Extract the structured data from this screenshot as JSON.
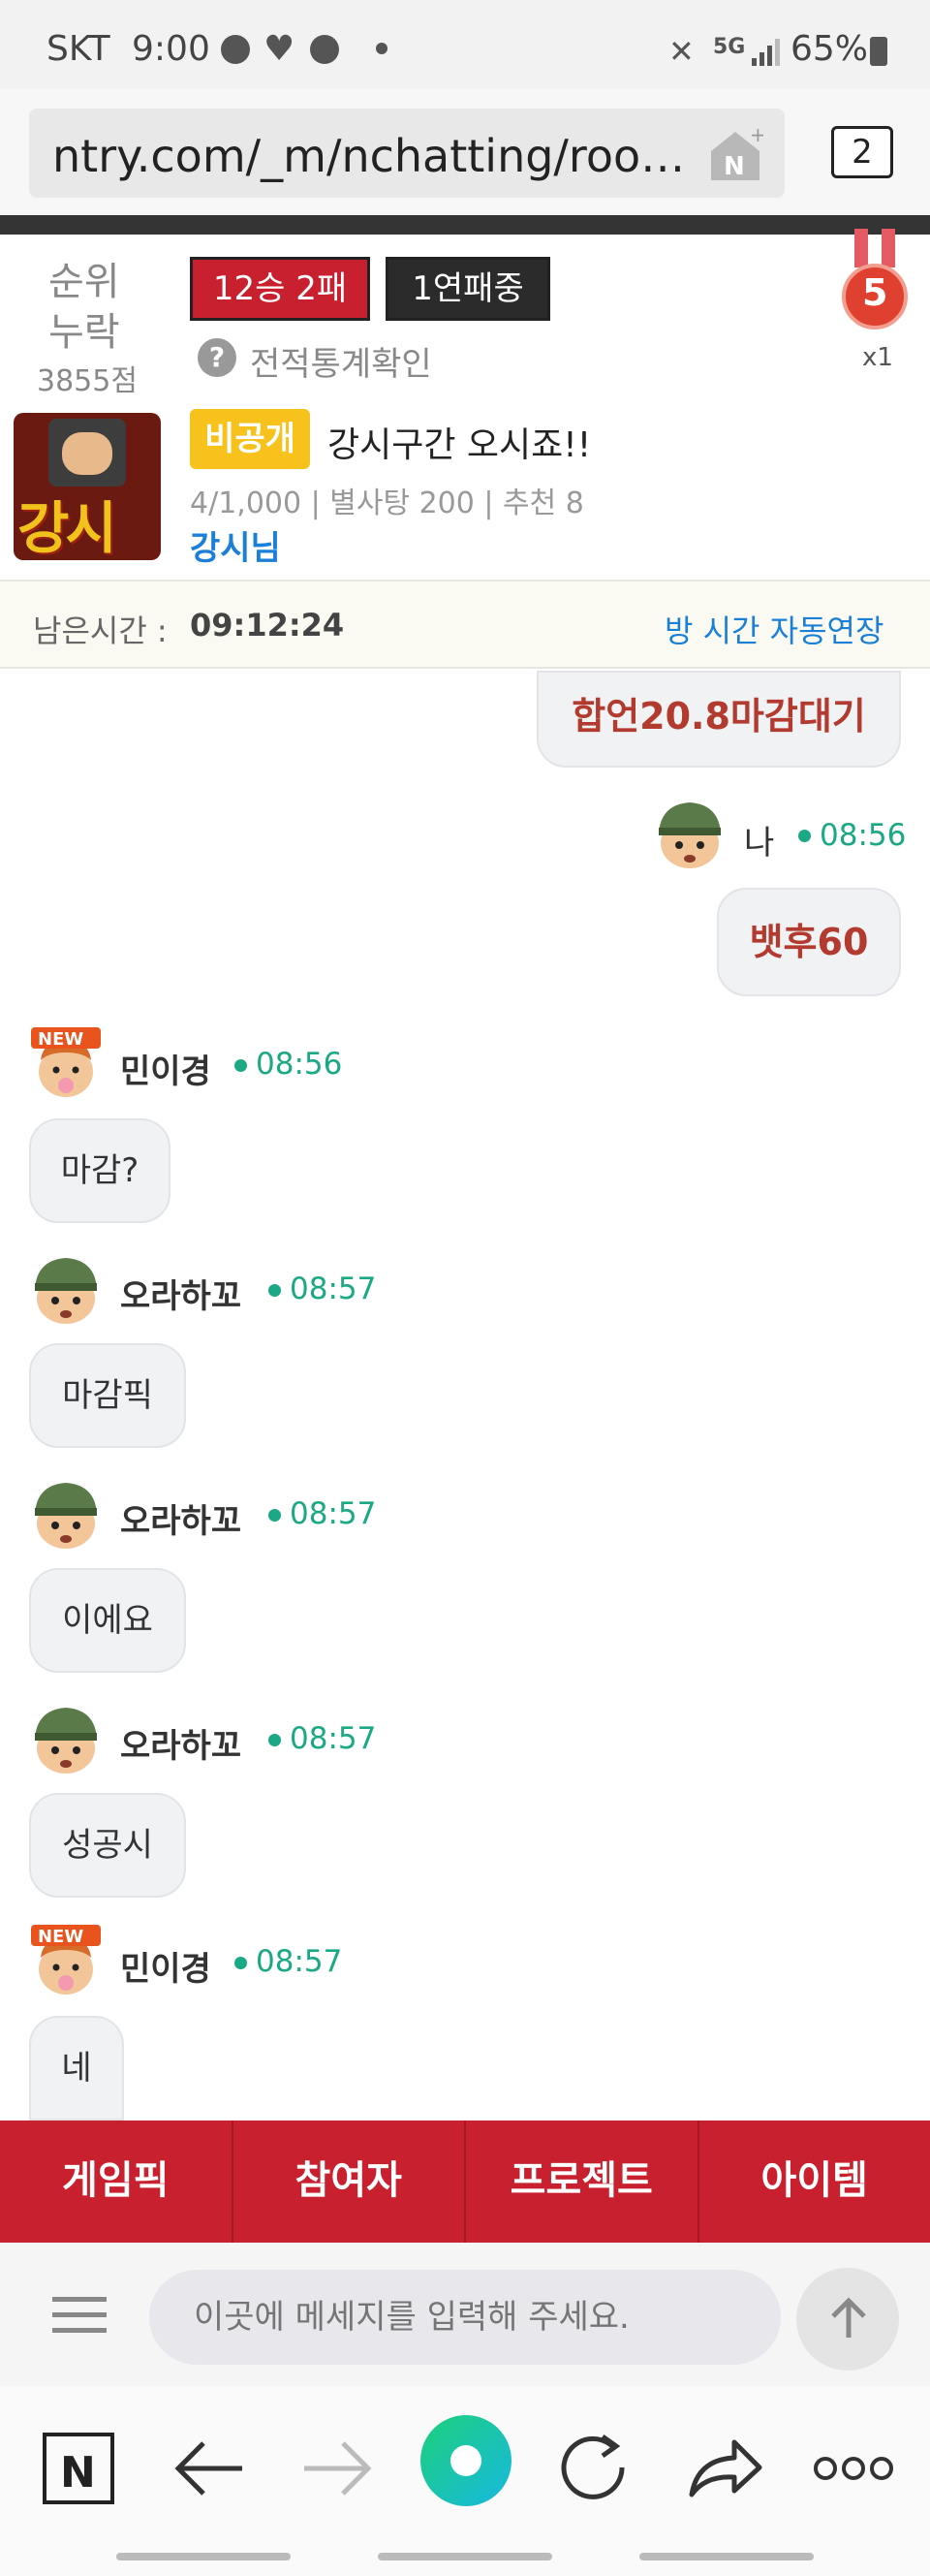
{
  "status_bar": {
    "carrier": "SKT",
    "time": "9:00",
    "battery": "65%"
  },
  "browser": {
    "url": "ntry.com/_m/nchatting/room...",
    "tab_count": "2"
  },
  "profile": {
    "rank_line1": "순위",
    "rank_line2": "누락",
    "points": "3855점",
    "record": "12승 2패",
    "streak": "1연패중",
    "stats_link": "전적통계확인",
    "medal_level": "5",
    "medal_count": "x1"
  },
  "room": {
    "privacy_badge": "비공개",
    "title": "강시구간 오시죠!!",
    "meta": "4/1,000 | 별사탕 200 | 추천 8",
    "host": "강시님",
    "logo_text": "강시"
  },
  "timer": {
    "label": "남은시간 :",
    "value": "09:12:24",
    "extend_link": "방 시간 자동연장"
  },
  "messages": [
    {
      "text": "합언20.8마감대기"
    },
    {
      "nick": "나",
      "time": "08:56",
      "text": "뱃후60"
    },
    {
      "nick": "민이경",
      "time": "08:56",
      "text": "마감?",
      "new_badge": "NEW"
    },
    {
      "nick": "오라하꼬",
      "time": "08:57",
      "text": "마감픽"
    },
    {
      "nick": "오라하꼬",
      "time": "08:57",
      "text": "이에요"
    },
    {
      "nick": "오라하꼬",
      "time": "08:57",
      "text": "성공시"
    },
    {
      "nick": "민이경",
      "time": "08:57",
      "text": "네",
      "new_badge": "NEW"
    }
  ],
  "bottom_tabs": [
    "게임픽",
    "참여자",
    "프로젝트",
    "아이템"
  ],
  "input": {
    "placeholder": "이곳에 메세지를 입력해 주세요."
  },
  "colors": {
    "accent_red": "#c8202e",
    "time_green": "#1ba884",
    "link_blue": "#1a7fd6",
    "badge_yellow": "#f7c21c"
  }
}
